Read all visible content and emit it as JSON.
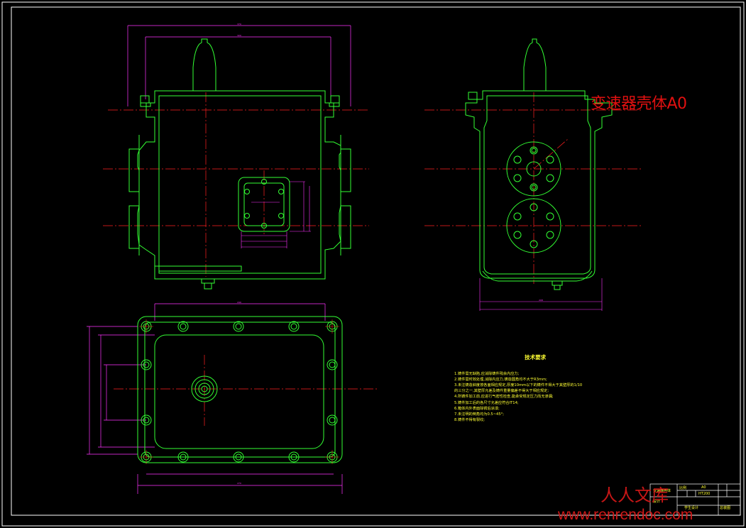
{
  "drawing": {
    "title": "变速器壳体A0",
    "watermark_cn": "人人文库",
    "watermark_url": "www.renrendoc.com"
  },
  "tech_requirements": {
    "heading": "技术要求",
    "items": [
      "1.铸件需无缺陷,应消除铸件残余内应力;",
      "2.铸件需时效处理,消除内应力,铸造圆角均不大于R3mm;",
      "3.未注铸造斜度按各面相应规定,厚度10mm以下的铸件不得大于其壁厚的1/10",
      "的三分之一,其壁厚允差及铸件重量偏差不得大于相应规定;",
      "4.所铸件加工前,应进行气密性检查,能承受规定压力而无渗漏;",
      "5.铸件加工后的各尺寸允差应符合IT14;",
      "6.箱体内外表面除锈后涂漆;",
      "7.未注明的倒角均为0.5~45°;",
      "8.铸件不得有裂纹;"
    ]
  },
  "title_block": {
    "part_name": "变速器壳体",
    "scale_label": "比例",
    "scale_value": "A0",
    "designer_row": "设计",
    "material": "HT200",
    "school_label": "学生设计",
    "drawing_no": "总装图"
  },
  "colors": {
    "outline": "#33ff33",
    "dimension": "#ff33ff",
    "centerline": "#ff2020",
    "text": "#ffff33",
    "frame": "#ffffff",
    "background": "#000000"
  }
}
